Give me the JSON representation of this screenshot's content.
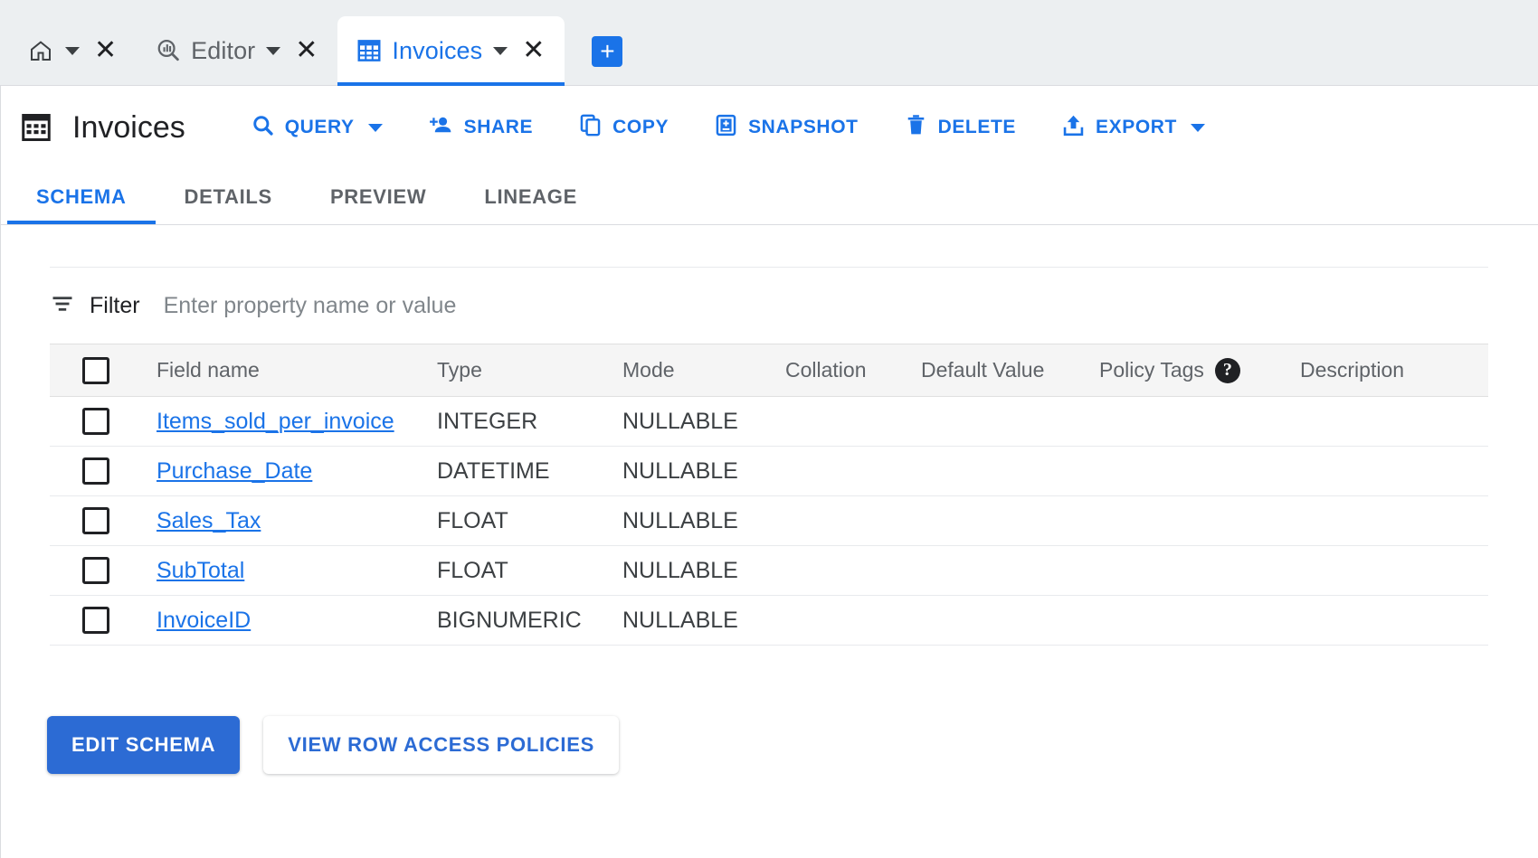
{
  "tabbar": {
    "tabs": [
      {
        "id": "home",
        "label": "",
        "icon": "home-icon",
        "has_caret": true,
        "has_close": true,
        "active": false
      },
      {
        "id": "editor",
        "label": "Editor",
        "icon": "query-icon",
        "has_caret": true,
        "has_close": true,
        "active": false
      },
      {
        "id": "invoices",
        "label": "Invoices",
        "icon": "table-icon",
        "has_caret": true,
        "has_close": true,
        "active": true
      }
    ],
    "add_tab_label": "+",
    "close_glyph": "✕"
  },
  "header": {
    "icon": "table-icon",
    "title": "Invoices",
    "actions": [
      {
        "id": "query",
        "label": "QUERY",
        "icon": "search-icon",
        "has_caret": true
      },
      {
        "id": "share",
        "label": "SHARE",
        "icon": "person-add-icon",
        "has_caret": false
      },
      {
        "id": "copy",
        "label": "COPY",
        "icon": "copy-icon",
        "has_caret": false
      },
      {
        "id": "snapshot",
        "label": "SNAPSHOT",
        "icon": "snapshot-icon",
        "has_caret": false
      },
      {
        "id": "delete",
        "label": "DELETE",
        "icon": "trash-icon",
        "has_caret": false
      },
      {
        "id": "export",
        "label": "EXPORT",
        "icon": "export-icon",
        "has_caret": true
      }
    ]
  },
  "subtabs": [
    {
      "id": "schema",
      "label": "SCHEMA",
      "active": true
    },
    {
      "id": "details",
      "label": "DETAILS",
      "active": false
    },
    {
      "id": "preview",
      "label": "PREVIEW",
      "active": false
    },
    {
      "id": "lineage",
      "label": "LINEAGE",
      "active": false
    }
  ],
  "filter": {
    "icon": "filter-icon",
    "label": "Filter",
    "value": "",
    "placeholder": "Enter property name or value"
  },
  "schema_table": {
    "columns": [
      {
        "id": "field_name",
        "label": "Field name"
      },
      {
        "id": "type",
        "label": "Type"
      },
      {
        "id": "mode",
        "label": "Mode"
      },
      {
        "id": "collation",
        "label": "Collation"
      },
      {
        "id": "default_value",
        "label": "Default Value"
      },
      {
        "id": "policy_tags",
        "label": "Policy Tags",
        "help_icon": "help-icon",
        "help_glyph": "?"
      },
      {
        "id": "description",
        "label": "Description"
      }
    ],
    "rows": [
      {
        "field_name": "Items_sold_per_invoice",
        "type": "INTEGER",
        "mode": "NULLABLE",
        "collation": "",
        "default_value": "",
        "policy_tags": "",
        "description": ""
      },
      {
        "field_name": "Purchase_Date",
        "type": "DATETIME",
        "mode": "NULLABLE",
        "collation": "",
        "default_value": "",
        "policy_tags": "",
        "description": ""
      },
      {
        "field_name": "Sales_Tax",
        "type": "FLOAT",
        "mode": "NULLABLE",
        "collation": "",
        "default_value": "",
        "policy_tags": "",
        "description": ""
      },
      {
        "field_name": "SubTotal",
        "type": "FLOAT",
        "mode": "NULLABLE",
        "collation": "",
        "default_value": "",
        "policy_tags": "",
        "description": ""
      },
      {
        "field_name": "InvoiceID",
        "type": "BIGNUMERIC",
        "mode": "NULLABLE",
        "collation": "",
        "default_value": "",
        "policy_tags": "",
        "description": ""
      }
    ]
  },
  "footer": {
    "edit_schema_label": "EDIT SCHEMA",
    "view_row_access_policies_label": "VIEW ROW ACCESS POLICIES"
  },
  "colors": {
    "accent": "#1a73e8",
    "primary_button": "#2c6bd4",
    "tabstrip_bg": "#eceff1",
    "text": "#202124",
    "muted_text": "#5f6368",
    "border": "#dadce0"
  }
}
